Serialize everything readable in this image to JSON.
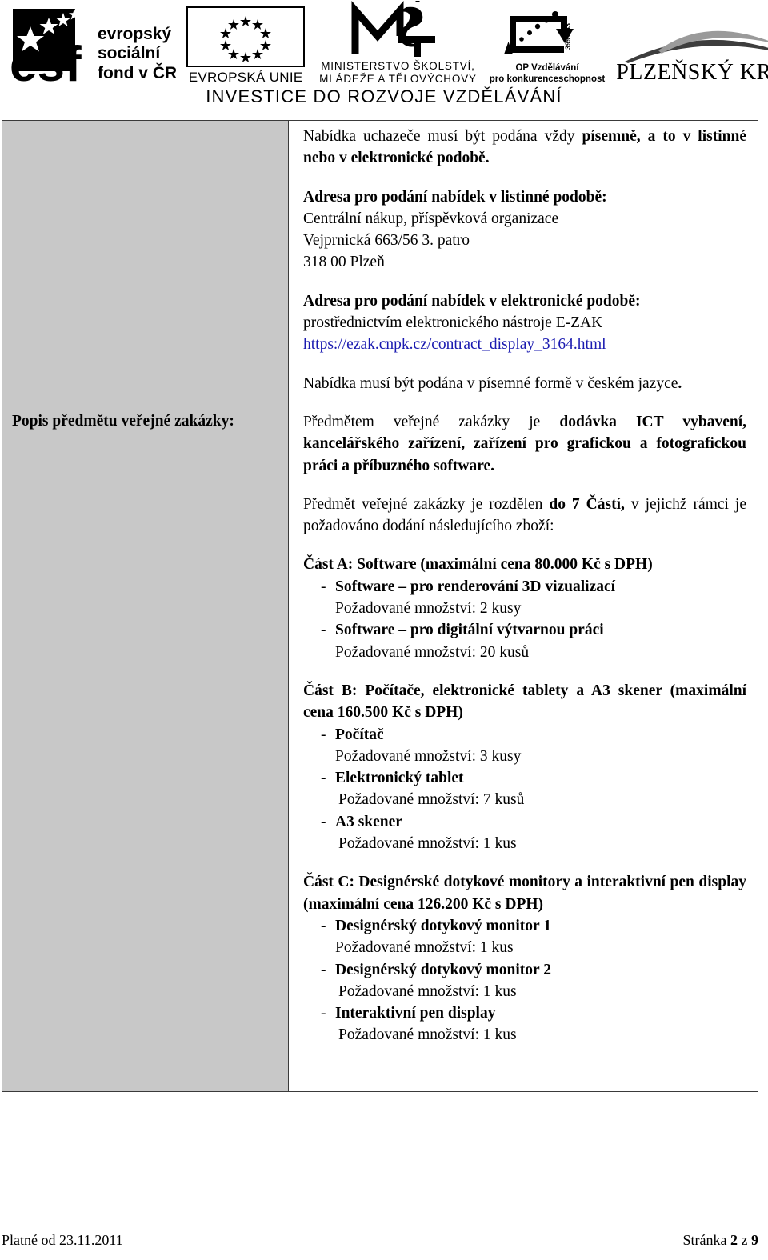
{
  "header": {
    "esf": {
      "line1": "evropský",
      "line2": "sociální",
      "line3": "fond v ČR"
    },
    "eu": {
      "caption": "EVROPSKÁ UNIE"
    },
    "msmt": {
      "caption_line1": "MINISTERSTVO ŠKOLSTVÍ,",
      "caption_line2": "MLÁDEŽE A TĚLOVÝCHOVY"
    },
    "op": {
      "code": "3997-43",
      "caption_line1": "OP Vzdělávání",
      "caption_line2": "pro konkurenceschopnost"
    },
    "region": {
      "caption": "PLZEŇSKÝ KRAJ"
    },
    "slogan": "INVESTICE DO ROZVOJE VZDĚLÁVÁNÍ"
  },
  "table": {
    "row1": {
      "label": "",
      "intro_normal": "Nabídka uchazeče musí být podána vždy ",
      "intro_bold": "písemně, a to v listinné nebo v elektronické podobě.",
      "addr_paper_heading": "Adresa pro podání nabídek v listinné podobě:",
      "addr_paper_line1": "Centrální nákup, příspěvková organizace",
      "addr_paper_line2": "Vejprnická 663/56 3. patro",
      "addr_paper_line3": "318 00 Plzeň",
      "addr_electronic_heading": "Adresa pro podání nabídek v elektronické podobě:",
      "addr_electronic_line1": "prostřednictvím elektronického nástroje E-ZAK",
      "addr_electronic_link": "https://ezak.cnpk.cz/contract_display_3164.html",
      "language_note": "Nabídka musí být podána v písemné formě v českém jazyce",
      "language_note_dot": "."
    },
    "row2": {
      "label": "Popis předmětu veřejné zakázky:",
      "subject_normal1": "Předmětem veřejné zakázky je ",
      "subject_bold": "dodávka ICT vybavení, kancelářského zařízení, zařízení pro grafickou a fotografickou práci a příbuzného software.",
      "split_normal1": "Předmět veřejné zakázky je rozdělen ",
      "split_bold": "do 7 Částí,",
      "split_normal2": " v jejichž rámci je požadováno dodání následujícího zboží:",
      "parts": [
        {
          "heading": "Část A: Software (maximální cena 80.000 Kč s DPH)",
          "items": [
            {
              "dash": "-",
              "name": "Software – pro renderování 3D vizualizací",
              "qty": "Požadované množství: 2 kusy"
            },
            {
              "dash": "-",
              "name": "Software – pro digitální výtvarnou práci",
              "qty": "Požadované množství: 20 kusů"
            }
          ]
        },
        {
          "heading": "Část B: Počítače, elektronické tablety a A3 skener (maximální cena 160.500 Kč s DPH)",
          "items": [
            {
              "dash": "-",
              "name": "Počítač",
              "qty": "Požadované množství: 3 kusy"
            },
            {
              "dash": "-",
              "name": "Elektronický tablet",
              "qty": "Požadované množství: 7 kusů"
            },
            {
              "dash": "-",
              "name": "A3 skener",
              "qty": "Požadované množství: 1 kus"
            }
          ]
        },
        {
          "heading": "Část C: Designérské dotykové monitory a interaktivní pen display (maximální cena 126.200 Kč s DPH)",
          "items": [
            {
              "dash": "-",
              "name": "Designérský dotykový monitor 1",
              "qty": "Požadované množství: 1 kus"
            },
            {
              "dash": "-",
              "name": "Designérský dotykový monitor 2",
              "qty": "Požadované množství: 1 kus"
            },
            {
              "dash": "-",
              "name": "Interaktivní pen display",
              "qty": "Požadované množství: 1 kus"
            }
          ]
        }
      ]
    }
  },
  "footer": {
    "valid_from": "Platné od 23.11.2011",
    "page_word": "Stránka",
    "page_current": "2",
    "page_of": "z",
    "page_total": "9"
  }
}
